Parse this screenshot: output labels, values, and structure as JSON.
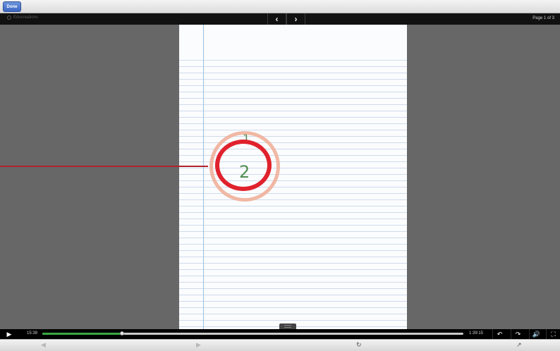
{
  "topbar": {
    "done_label": "Done"
  },
  "navbar": {
    "brand": "Educreations",
    "prev_icon": "chevron-left-icon",
    "next_icon": "chevron-right-icon",
    "page_indicator": "Page 1 of 3"
  },
  "canvas": {
    "handwriting": [
      "1",
      "2"
    ],
    "ink_color": "#4f8d50",
    "highlight_color": "#e0222d"
  },
  "player": {
    "play_glyph": "▶",
    "current_time": "15:39",
    "total_time": "1:39:15",
    "progress": 0.19,
    "buffered": 0.19,
    "accent": "#3aa741",
    "buttons": [
      "undo-icon",
      "redo-icon",
      "volume-icon",
      "fullscreen-icon"
    ]
  },
  "bottombar": {
    "icons": [
      "back-icon",
      "forward-icon",
      "reload-icon",
      "share-icon"
    ]
  }
}
